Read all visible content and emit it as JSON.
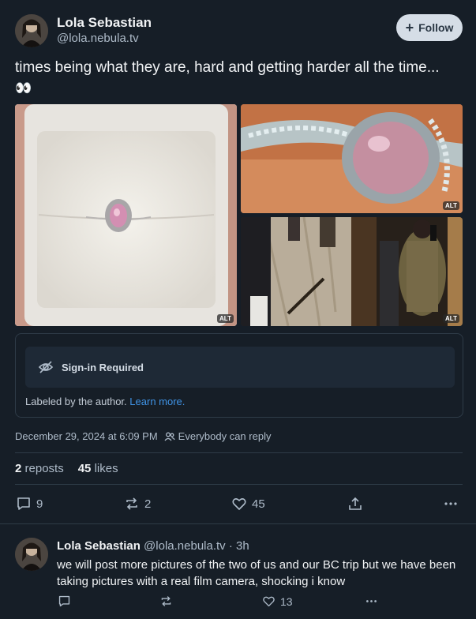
{
  "post": {
    "author_name": "Lola Sebastian",
    "author_handle": "@lola.nebula.tv",
    "follow_label": "Follow",
    "text": "times being what they are, hard and getting harder all the time...",
    "emoji": "👀",
    "images": [
      {
        "alt_badge": "ALT"
      },
      {
        "alt_badge": "ALT"
      },
      {
        "alt_badge": "ALT"
      }
    ],
    "content_warning": {
      "title": "Sign-in Required",
      "labeled_text": "Labeled by the author.",
      "learn_more": "Learn more."
    },
    "timestamp": "December 29, 2024 at 6:09 PM",
    "reply_setting": "Everybody can reply",
    "reposts_count": "2",
    "reposts_label": "reposts",
    "likes_count": "45",
    "likes_label": "likes",
    "actions": {
      "replies": "9",
      "reposts": "2",
      "likes": "45"
    }
  },
  "reply": {
    "author_name": "Lola Sebastian",
    "author_handle": "@lola.nebula.tv",
    "time": "· 3h",
    "text": "we will post more pictures of the two of us and our BC trip but we have been taking pictures with a real film camera, shocking i know",
    "likes": "13"
  },
  "colors": {
    "background": "#161e27",
    "accent_link": "#3f93e5",
    "muted_text": "#aebbc9",
    "divider": "#2e3b47"
  },
  "icons": [
    "plus-icon",
    "eye-slash-icon",
    "people-icon",
    "reply-icon",
    "repost-icon",
    "heart-icon",
    "share-icon",
    "more-icon"
  ]
}
